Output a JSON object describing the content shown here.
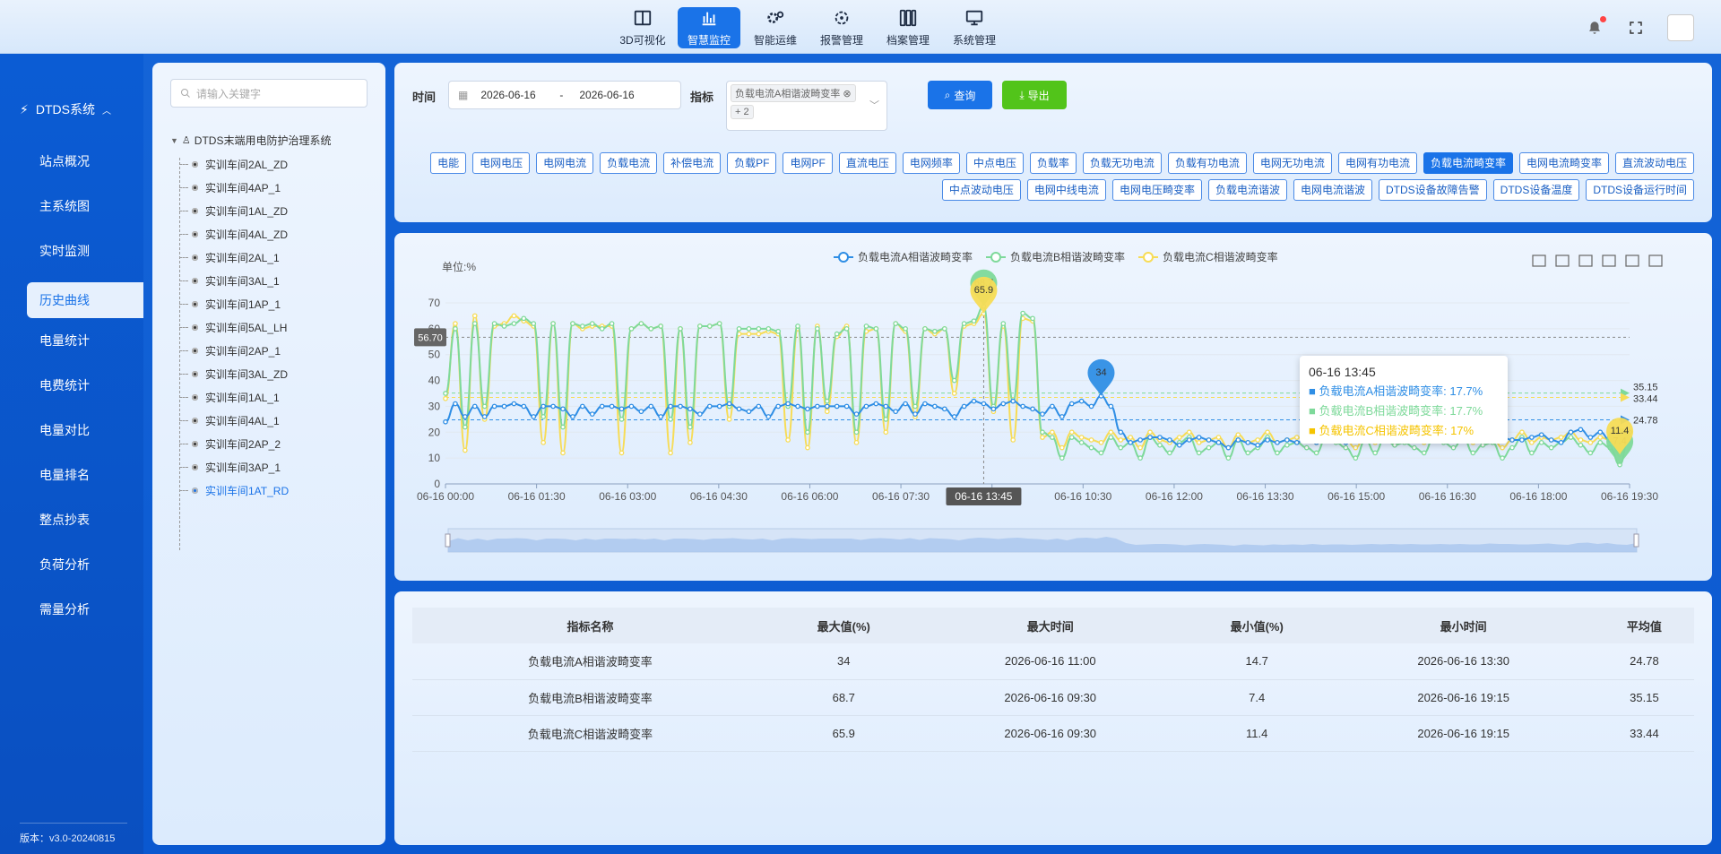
{
  "topnav": {
    "items": [
      {
        "label": "3D可视化",
        "icon": "layout-icon"
      },
      {
        "label": "智慧监控",
        "icon": "bar-chart-icon",
        "active": true
      },
      {
        "label": "智能运维",
        "icon": "gears-icon"
      },
      {
        "label": "报警管理",
        "icon": "alarm-gear-icon"
      },
      {
        "label": "档案管理",
        "icon": "archive-icon"
      },
      {
        "label": "系统管理",
        "icon": "monitor-icon"
      }
    ]
  },
  "sidebar": {
    "system_title": "DTDS系统",
    "items": [
      "站点概况",
      "主系统图",
      "实时监测",
      "历史曲线",
      "电量统计",
      "电费统计",
      "电量对比",
      "电量排名",
      "整点抄表",
      "负荷分析",
      "需量分析"
    ],
    "active_index": 3,
    "version": "版本：v3.0-20240815"
  },
  "tree": {
    "search_placeholder": "请输入关键字",
    "root_label": "DTDS末端用电防护治理系统",
    "nodes": [
      "实训车间2AL_ZD",
      "实训车间4AP_1",
      "实训车间1AL_ZD",
      "实训车间4AL_ZD",
      "实训车间2AL_1",
      "实训车间3AL_1",
      "实训车间1AP_1",
      "实训车间5AL_LH",
      "实训车间2AP_1",
      "实训车间3AL_ZD",
      "实训车间1AL_1",
      "实训车间4AL_1",
      "实训车间2AP_2",
      "实训车间3AP_1",
      "实训车间1AT_RD"
    ],
    "active_index": 14
  },
  "filter": {
    "time_label": "时间",
    "date_start": "2026-06-16",
    "date_sep": "-",
    "date_end": "2026-06-16",
    "metric_label": "指标",
    "selected_tag": "负载电流A相谐波畸变率",
    "more_tag": "+ 2",
    "query_label": "查询",
    "export_label": "导出",
    "metric_tags": [
      "电能",
      "电网电压",
      "电网电流",
      "负载电流",
      "补偿电流",
      "负载PF",
      "电网PF",
      "直流电压",
      "电网频率",
      "中点电压",
      "负载率",
      "负载无功电流",
      "负载有功电流",
      "电网无功电流",
      "电网有功电流",
      "负载电流畸变率",
      "电网电流畸变率",
      "直流波动电压",
      "中点波动电压",
      "电网中线电流",
      "电网电压畸变率",
      "负载电流谐波",
      "电网电流谐波",
      "DTDS设备故障告警",
      "DTDS设备温度",
      "DTDS设备运行时间"
    ],
    "active_tag_index": 15
  },
  "chart_data": {
    "type": "line",
    "unit_label": "单位:%",
    "ylim": [
      0,
      70
    ],
    "yticks": [
      0,
      10,
      20,
      30,
      40,
      50,
      60,
      70
    ],
    "xticks": [
      "06-16 00:00",
      "06-16 01:30",
      "06-16 03:00",
      "06-16 04:30",
      "06-16 06:00",
      "06-16 07:30",
      "06-16 09:00",
      "06-16 10:30",
      "06-16 12:00",
      "06-16 13:30",
      "06-16 15:00",
      "06-16 16:30",
      "06-16 18:00",
      "06-16 19:30"
    ],
    "x_interval_min": 15,
    "series": [
      {
        "name": "负载电流A相谐波畸变率",
        "color": "#2f8ee5",
        "values": [
          24,
          31,
          26,
          30,
          26,
          30,
          30,
          31,
          30,
          26,
          30,
          30,
          29,
          26,
          30,
          27,
          30,
          30,
          29,
          30,
          28,
          30,
          26,
          30,
          30,
          29,
          27,
          30,
          30,
          31,
          29,
          28,
          30,
          26,
          30,
          31,
          30,
          29,
          30,
          30,
          30,
          30,
          27,
          30,
          31,
          30,
          28,
          31,
          27,
          31,
          30,
          29,
          26,
          30,
          32,
          31,
          29,
          31,
          32,
          30,
          29,
          27,
          30,
          26,
          31,
          32,
          30,
          34,
          30,
          20,
          16,
          17,
          18,
          18,
          17,
          15,
          17,
          18,
          17,
          16,
          14,
          17,
          16,
          15,
          17,
          16,
          17,
          16,
          18,
          16,
          17,
          17,
          16,
          17,
          18,
          17,
          18,
          17,
          18,
          17,
          17,
          18,
          17,
          18,
          17,
          17,
          19,
          18,
          18,
          17,
          17,
          18,
          19,
          17,
          16,
          20,
          21,
          18,
          20,
          17,
          16,
          20
        ]
      },
      {
        "name": "负载电流B相谐波畸变率",
        "color": "#7ed99a",
        "values": [
          35,
          60,
          22,
          62,
          30,
          62,
          61,
          62,
          64,
          62,
          26,
          62,
          22,
          62,
          61,
          62,
          60,
          62,
          25,
          60,
          62,
          60,
          61,
          25,
          60,
          22,
          61,
          61,
          62,
          30,
          60,
          60,
          60,
          60,
          59,
          30,
          61,
          20,
          60,
          32,
          58,
          60,
          20,
          61,
          60,
          25,
          62,
          60,
          30,
          60,
          59,
          60,
          40,
          62,
          63,
          68.7,
          30,
          62,
          32,
          66,
          64,
          20,
          18,
          10,
          18,
          16,
          14,
          12,
          18,
          14,
          16,
          10,
          18,
          15,
          12,
          16,
          18,
          12,
          14,
          16,
          10,
          17,
          12,
          14,
          18,
          12,
          15,
          16,
          14,
          12,
          18,
          16,
          14,
          10,
          17,
          12,
          18,
          15,
          16,
          14,
          12,
          18,
          16,
          14,
          18,
          12,
          15,
          16,
          10,
          14,
          18,
          12,
          16,
          14,
          16,
          18,
          15,
          12,
          16,
          14,
          7.4,
          20
        ]
      },
      {
        "name": "负载电流C相谐波畸变率",
        "color": "#f7dc56",
        "values": [
          33,
          62,
          13,
          65,
          25,
          61,
          62,
          65,
          63,
          61,
          16,
          62,
          12,
          62,
          60,
          61,
          61,
          61,
          12,
          60,
          62,
          60,
          61,
          12,
          60,
          16,
          61,
          61,
          62,
          25,
          58,
          58,
          58,
          59,
          58,
          17,
          60,
          14,
          61,
          28,
          57,
          61,
          16,
          59,
          60,
          20,
          62,
          59,
          26,
          60,
          58,
          60,
          35,
          61,
          62,
          65.9,
          28,
          61,
          17,
          64,
          63,
          18,
          20,
          14,
          20,
          18,
          17,
          16,
          20,
          17,
          18,
          14,
          20,
          17,
          16,
          18,
          20,
          16,
          17,
          18,
          14,
          19,
          16,
          17,
          20,
          16,
          17,
          18,
          17,
          16,
          20,
          18,
          17,
          14,
          19,
          16,
          20,
          17,
          18,
          17,
          16,
          20,
          18,
          17,
          20,
          16,
          17,
          18,
          14,
          17,
          20,
          16,
          18,
          17,
          18,
          20,
          17,
          16,
          18,
          17,
          11.4,
          20
        ]
      }
    ],
    "markers": [
      {
        "series": 0,
        "label": "34"
      },
      {
        "series": 0,
        "label": "14.7"
      },
      {
        "series": 1,
        "label": "68.7"
      },
      {
        "series": 1,
        "label": "7.4"
      },
      {
        "series": 2,
        "label": "65.9"
      },
      {
        "series": 2,
        "label": "11.4"
      }
    ],
    "avg_lines": [
      {
        "series": 0,
        "value": 24.78,
        "label": "24.78"
      },
      {
        "series": 1,
        "value": 35.15,
        "label": "35.15"
      },
      {
        "series": 2,
        "value": 33.44,
        "label": "33.44"
      }
    ],
    "cursor_y_label": "56.70",
    "cursor_x_label": "06-16 13:45",
    "tooltip": {
      "title": "06-16 13:45",
      "rows": [
        "负载电流A相谐波畸变率: 17.7%",
        "负载电流B相谐波畸变率: 17.7%",
        "负载电流C相谐波畸变率: 17%"
      ]
    }
  },
  "table": {
    "headers": [
      "指标名称",
      "最大值(%)",
      "最大时间",
      "最小值(%)",
      "最小时间",
      "平均值"
    ],
    "rows": [
      [
        "负载电流A相谐波畸变率",
        "34",
        "2026-06-16 11:00",
        "14.7",
        "2026-06-16 13:30",
        "24.78"
      ],
      [
        "负载电流B相谐波畸变率",
        "68.7",
        "2026-06-16 09:30",
        "7.4",
        "2026-06-16 19:15",
        "35.15"
      ],
      [
        "负载电流C相谐波畸变率",
        "65.9",
        "2026-06-16 09:30",
        "11.4",
        "2026-06-16 19:15",
        "33.44"
      ]
    ]
  }
}
